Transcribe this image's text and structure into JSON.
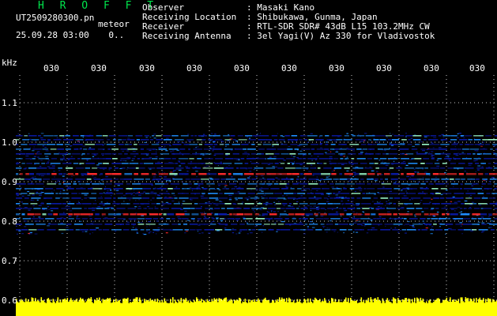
{
  "header": {
    "brand": "H R O F F T",
    "filename": "UT2509280300.pn",
    "tag": "meteor",
    "datetime": "25.09.28 03:00",
    "datetime_extra": "0..",
    "info": [
      {
        "key": "Observer",
        "value": "Masaki Kano"
      },
      {
        "key": "Receiving Location",
        "value": "Shibukawa, Gunma, Japan"
      },
      {
        "key": "Receiver",
        "value": "RTL-SDR SDR# 43dB L15 103.2MHz CW"
      },
      {
        "key": "Receiving Antenna",
        "value": "3el Yagi(V) Az 330 for Vladivostok"
      }
    ]
  },
  "axis": {
    "unit": "kHz",
    "y_ticks": [
      "1.1",
      "1.0",
      "0.9",
      "0.8",
      "0.7",
      "0.6"
    ],
    "x_ticks": [
      "030",
      "030",
      "030",
      "030",
      "030",
      "030",
      "030",
      "030",
      "030",
      "030",
      "0310"
    ]
  },
  "colors": {
    "background": "#000000",
    "grid": "#ffffff",
    "signal_low": "#0a1aa8",
    "signal_mid": "#1f8fff",
    "signal_high": "#ff2b2b",
    "baseline": "#ffff00",
    "brand": "#00e64d"
  }
}
